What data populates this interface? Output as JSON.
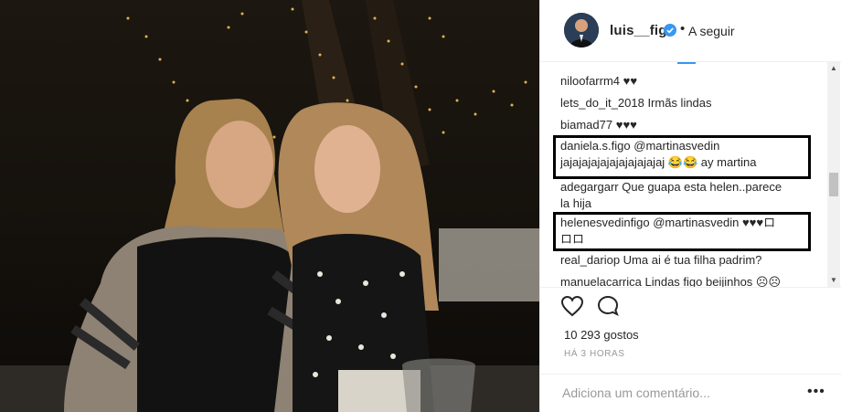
{
  "header": {
    "username": "luis__figo",
    "separator": "•",
    "follow_label": "A seguir"
  },
  "comments": [
    {
      "user": "niloofarrm4",
      "text": "♥♥"
    },
    {
      "user": "lets_do_it_2018",
      "text": "Irmãs lindas"
    },
    {
      "user": "biamad77",
      "text": "♥♥♥"
    },
    {
      "user": "daniela.s.figo",
      "text": "@martinasvedin",
      "text2": "jajajajajajajajajajajaj 😂😂 ay martina"
    },
    {
      "user": "adegargarr",
      "text": "Que guapa esta helen..parece",
      "text2": "la hija"
    },
    {
      "user": "helenesvedinfigo",
      "text": "@martinasvedin ♥♥♥ロ",
      "text2": "ロロ"
    },
    {
      "user": "real_dariop",
      "text": "Uma ai é tua filha padrim?"
    },
    {
      "user": "manuelacarrica",
      "text": "Lindas figo beijinhos ☹☹"
    }
  ],
  "actions": {
    "like_icon": "heart-icon",
    "comment_icon": "comment-icon"
  },
  "likes": "10 293 gostos",
  "time": "HÁ 3 HORAS",
  "add_comment": {
    "placeholder": "Adiciona um comentário...",
    "more": "•••"
  },
  "colors": {
    "text": "#262626",
    "muted": "#999999",
    "verified": "#3897f0"
  }
}
